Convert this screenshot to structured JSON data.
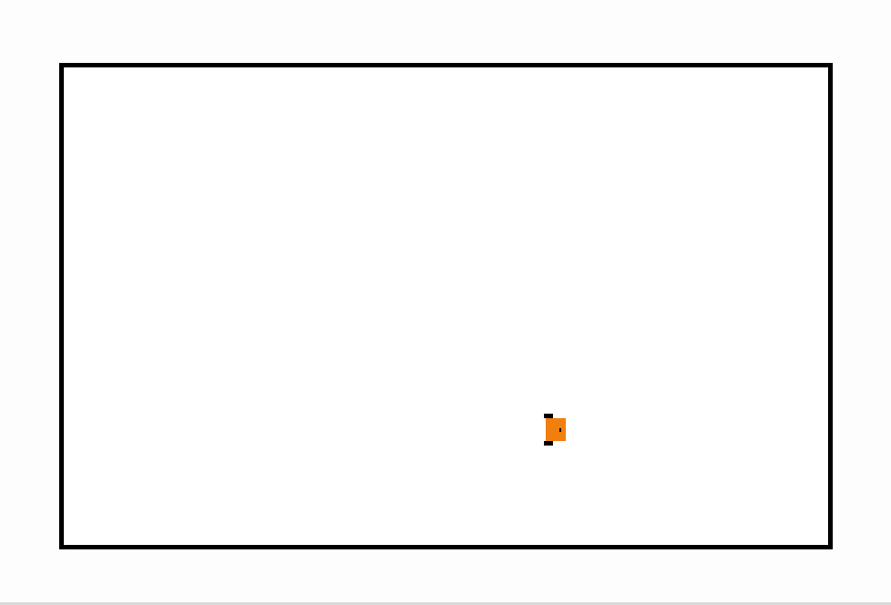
{
  "scene": {
    "background_color": "#fdfdfd",
    "arena": {
      "border_color": "#000000",
      "fill_color": "#ffffff"
    },
    "robot": {
      "body_color": "#f07f0e",
      "wheel_color": "#000000",
      "heading": "right"
    }
  }
}
